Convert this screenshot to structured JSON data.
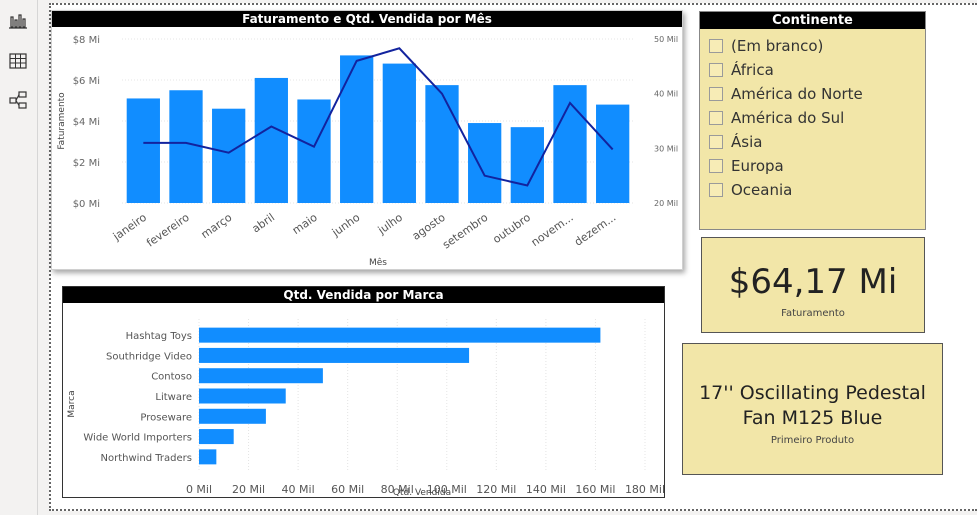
{
  "rail": {
    "icons": [
      "report-view-icon",
      "table-view-icon",
      "model-view-icon"
    ]
  },
  "colors": {
    "bar": "#118dff",
    "line": "#12239e",
    "card_bg": "#f2e6a8",
    "title_bg": "#000000"
  },
  "charts": {
    "monthly": {
      "title": "Faturamento e Qtd. Vendida por Mês",
      "xlabel": "Mês",
      "ylabel": "Faturamento"
    },
    "brand": {
      "title": "Qtd. Vendida por Marca",
      "xlabel": "Qtd. Vendida",
      "ylabel": "Marca"
    }
  },
  "slicer": {
    "title": "Continente",
    "items": [
      "(Em branco)",
      "África",
      "América do Norte",
      "América do Sul",
      "Ásia",
      "Europa",
      "Oceania"
    ]
  },
  "card_revenue": {
    "value": "$64,17 Mi",
    "label": "Faturamento"
  },
  "card_product": {
    "line1": "17'' Oscillating Pedestal",
    "line2": "Fan M125 Blue",
    "label": "Primeiro Produto"
  },
  "chart_data": [
    {
      "type": "bar",
      "title": "Faturamento e Qtd. Vendida por Mês",
      "categories": [
        "janeiro",
        "fevereiro",
        "março",
        "abril",
        "maio",
        "junho",
        "julho",
        "agosto",
        "setembro",
        "outubro",
        "novem...",
        "dezem..."
      ],
      "series": [
        {
          "type": "bar",
          "axis": "left",
          "values": [
            5.1,
            5.5,
            4.6,
            6.1,
            5.05,
            7.2,
            6.8,
            5.75,
            3.9,
            3.7,
            5.75,
            4.8
          ]
        },
        {
          "type": "line",
          "axis": "right",
          "values": [
            31,
            31,
            29.2,
            34,
            30.3,
            46,
            48.3,
            40,
            25,
            23.2,
            38.3,
            29.8
          ]
        }
      ],
      "y_ticks": [
        "$0 Mi",
        "$2 Mi",
        "$4 Mi",
        "$6 Mi",
        "$8 Mi"
      ],
      "y2_ticks": [
        "20 Mil",
        "30 Mil",
        "40 Mil",
        "50 Mil"
      ],
      "ylim": [
        0,
        8
      ],
      "y2lim": [
        20,
        50
      ],
      "xlabel": "Mês",
      "ylabel": "Faturamento"
    },
    {
      "type": "bar",
      "orientation": "horizontal",
      "title": "Qtd. Vendida por Marca",
      "categories": [
        "Hashtag Toys",
        "Southridge Video",
        "Contoso",
        "Litware",
        "Proseware",
        "Wide World Importers",
        "Northwind Traders"
      ],
      "values": [
        162,
        109,
        50,
        35,
        27,
        14,
        7
      ],
      "x_ticks": [
        "0 Mil",
        "20 Mil",
        "40 Mil",
        "60 Mil",
        "80 Mil",
        "100 Mil",
        "120 Mil",
        "140 Mil",
        "160 Mil",
        "180 Mil"
      ],
      "xlim": [
        0,
        180
      ],
      "xlabel": "Qtd. Vendida",
      "ylabel": "Marca"
    }
  ]
}
